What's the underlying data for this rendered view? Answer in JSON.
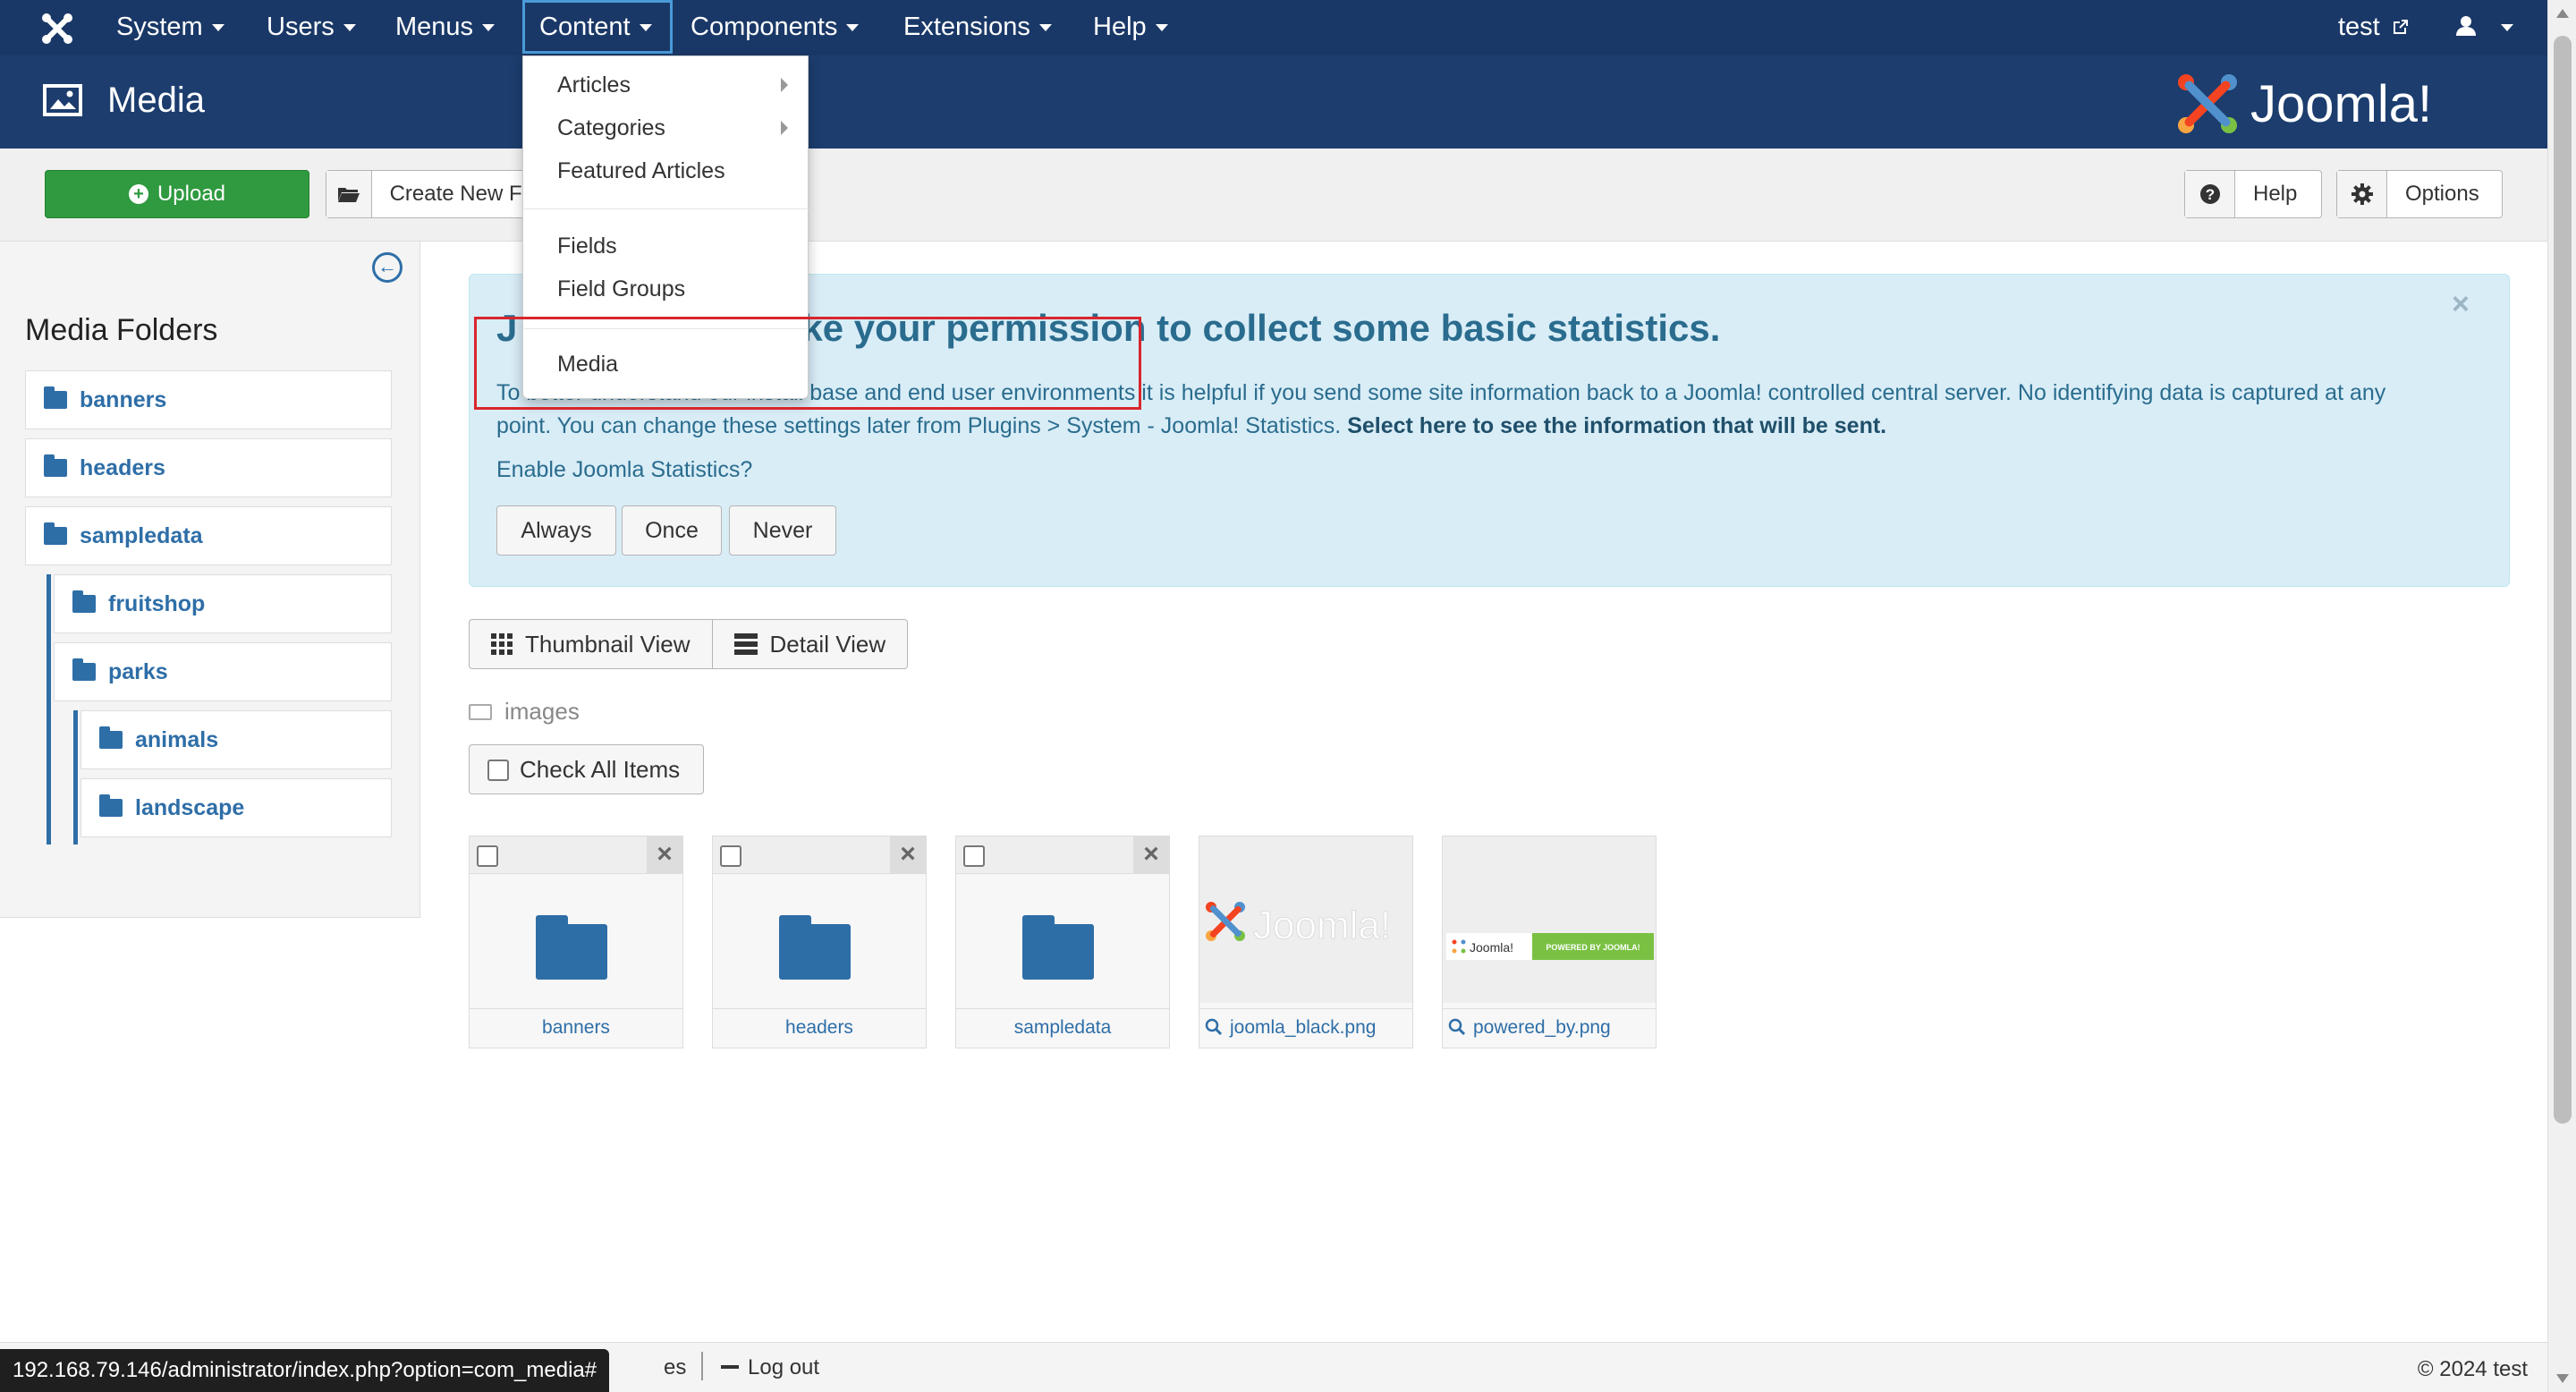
{
  "colors": {
    "navbar": "#1a3867",
    "header": "#1c3d6e",
    "upload_green": "#2f9a3f",
    "link_blue": "#2e6ea7",
    "alert_bg": "#d9edf7",
    "highlight_red": "#d9262d"
  },
  "navbar": {
    "logo_icon": "joomla-icon",
    "items": [
      {
        "label": "System"
      },
      {
        "label": "Users"
      },
      {
        "label": "Menus"
      },
      {
        "label": "Content"
      },
      {
        "label": "Components"
      },
      {
        "label": "Extensions"
      },
      {
        "label": "Help"
      }
    ],
    "site_link": "test",
    "user_icon": "user-icon"
  },
  "header": {
    "title": "Media",
    "icon": "image-icon",
    "brand": "Joomla!"
  },
  "toolbar": {
    "upload_label": "Upload",
    "create_folder_label": "Create New F",
    "help_label": "Help",
    "options_label": "Options"
  },
  "content_menu": {
    "items": [
      {
        "label": "Articles"
      },
      {
        "label": "Categories"
      },
      {
        "label": "Featured Articles"
      },
      {
        "label": "Fields"
      },
      {
        "label": "Field Groups"
      },
      {
        "label": "Media"
      }
    ]
  },
  "sidebar": {
    "title": "Media Folders",
    "folders": [
      {
        "label": "banners"
      },
      {
        "label": "headers"
      },
      {
        "label": "sampledata"
      },
      {
        "label": "fruitshop"
      },
      {
        "label": "parks"
      },
      {
        "label": "animals"
      },
      {
        "label": "landscape"
      }
    ]
  },
  "alert": {
    "title_start": "J",
    "title_end": "ke your permission to collect some basic statistics.",
    "text_line1": "To better understand our install base and end user environments it is helpful if you send some site information back to a Joomla! controlled central server. No identifying data is captured at any",
    "text_line2": "point. You can change these settings later from Plugins > System - Joomla! Statistics.",
    "text_bold": "Select here to see the information that will be sent.",
    "question": "Enable Joomla Statistics?",
    "buttons": {
      "always": "Always",
      "once": "Once",
      "never": "Never"
    },
    "close": "×"
  },
  "views": {
    "thumbnail": "Thumbnail View",
    "detail": "Detail View"
  },
  "breadcrumb": "images",
  "check_all": "Check All Items",
  "items": [
    {
      "name": "banners",
      "type": "folder"
    },
    {
      "name": "headers",
      "type": "folder"
    },
    {
      "name": "sampledata",
      "type": "folder"
    },
    {
      "name": "joomla_black.png",
      "type": "image"
    },
    {
      "name": "powered_by.png",
      "type": "image",
      "badge": "POWERED BY JOOMLA!"
    }
  ],
  "footer": {
    "partial": "es",
    "logout": "Log out",
    "copyright": "© 2024 test"
  },
  "status_url": "192.168.79.146/administrator/index.php?option=com_media#"
}
